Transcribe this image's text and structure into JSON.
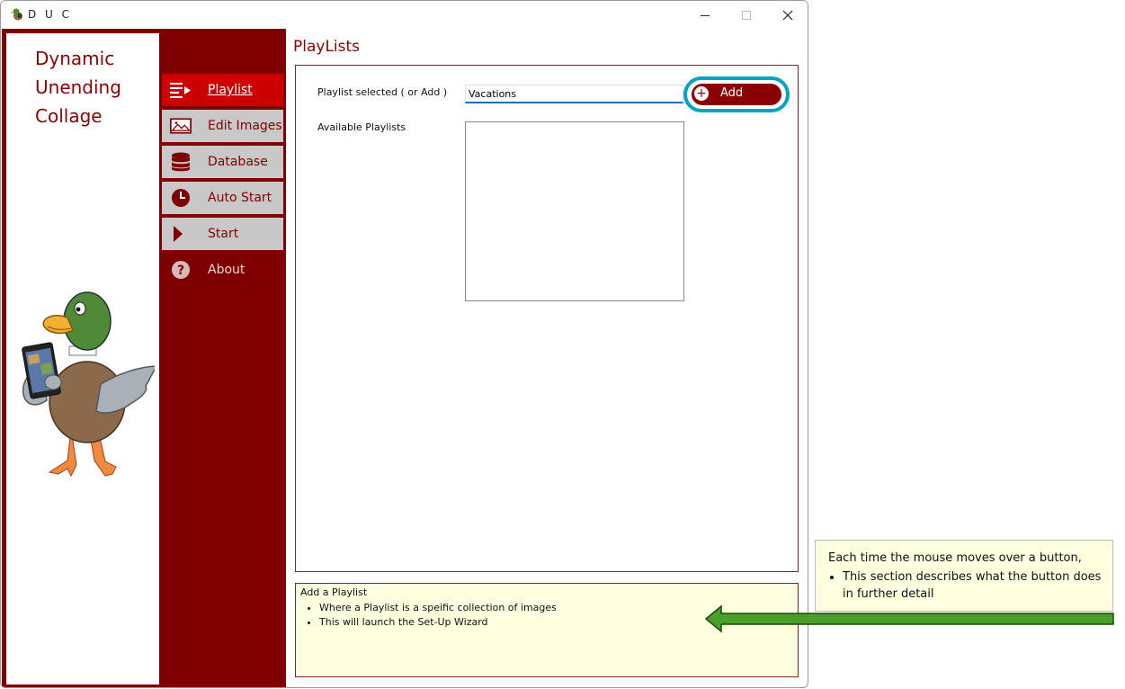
{
  "window": {
    "title": "D U C",
    "controls": [
      "minimize-icon",
      "maximize-icon",
      "close-icon"
    ]
  },
  "app_name": {
    "line1": "Dynamic",
    "line2": "Unending",
    "line3": "Collage"
  },
  "nav": {
    "items": [
      {
        "label": "Playlist",
        "icon": "playlist-icon",
        "active": true
      },
      {
        "label": "Edit Images",
        "icon": "image-icon"
      },
      {
        "label": "Database",
        "icon": "database-icon"
      },
      {
        "label": "Auto Start",
        "icon": "clock-icon"
      },
      {
        "label": "Start",
        "icon": "play-icon"
      },
      {
        "label": "About",
        "icon": "help-icon"
      }
    ]
  },
  "main": {
    "title": "PlayLists",
    "selected_label": "Playlist selected ( or Add )",
    "selected_value": "Vacations",
    "add_label": "Add",
    "available_label": "Available Playlists",
    "available_items": []
  },
  "help": {
    "title": "Add a Playlist",
    "bullets": [
      "Where a Playlist is a speific collection of images",
      "This will launch the Set-Up Wizard"
    ]
  },
  "callout": {
    "line1": "Each time the mouse moves over a button,",
    "bullet": "This section describes what the button does in further detail"
  },
  "colors": {
    "brand": "#7f0000",
    "active_nav": "#cc0000",
    "nav_inactive": "#c8c8c8",
    "highlight": "#00a3c4",
    "help_bg": "#ffffe0",
    "arrow": "#4a9e2a"
  }
}
